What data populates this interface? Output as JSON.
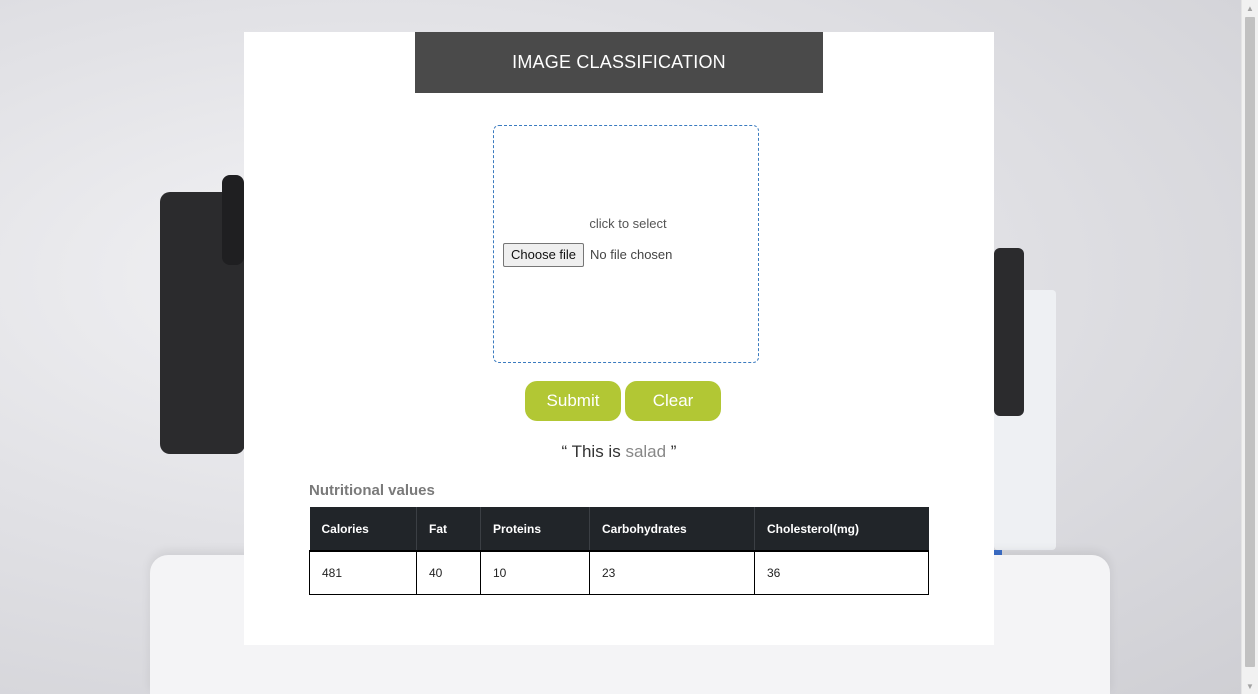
{
  "header": {
    "title": "IMAGE CLASSIFICATION"
  },
  "upload": {
    "prompt": "click to select",
    "choose_label": "Choose file",
    "file_status": "No file chosen"
  },
  "buttons": {
    "submit": "Submit",
    "clear": "Clear"
  },
  "result": {
    "prefix": "“ This is ",
    "class_name": "salad",
    "suffix": " ”"
  },
  "nutrition": {
    "title": "Nutritional values",
    "columns": [
      "Calories",
      "Fat",
      "Proteins",
      "Carbohydrates",
      "Cholesterol(mg)"
    ],
    "values": [
      "481",
      "40",
      "10",
      "23",
      "36"
    ]
  },
  "colors": {
    "accent": "#b2c734",
    "header_bg": "#4a4a4a",
    "table_header_bg": "#212529",
    "dropzone_border": "#3b7bbf"
  }
}
